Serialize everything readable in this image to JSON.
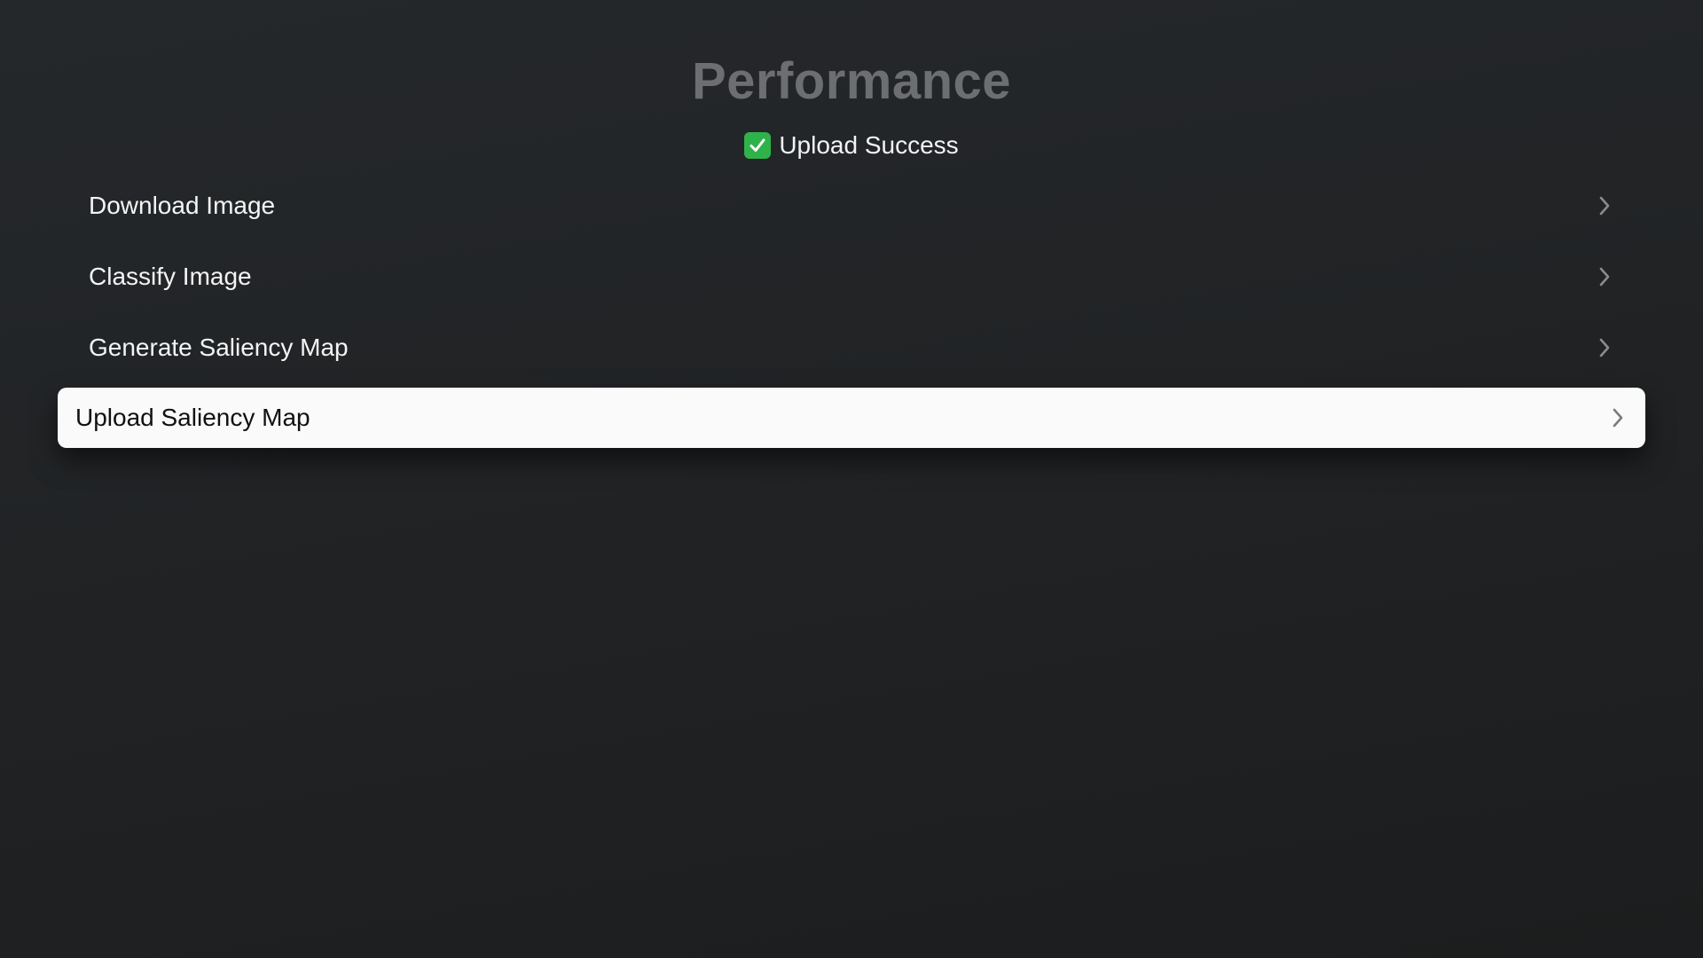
{
  "page": {
    "title": "Performance"
  },
  "status": {
    "icon": "check-mark-button-icon",
    "text": "Upload Success",
    "color": "#2fb24a"
  },
  "menu": {
    "items": [
      {
        "label": "Download Image",
        "icon": "chevron-right-icon",
        "focused": false
      },
      {
        "label": "Classify Image",
        "icon": "chevron-right-icon",
        "focused": false
      },
      {
        "label": "Generate Saliency Map",
        "icon": "chevron-right-icon",
        "focused": false
      },
      {
        "label": "Upload Saliency Map",
        "icon": "chevron-right-icon",
        "focused": true
      }
    ]
  }
}
